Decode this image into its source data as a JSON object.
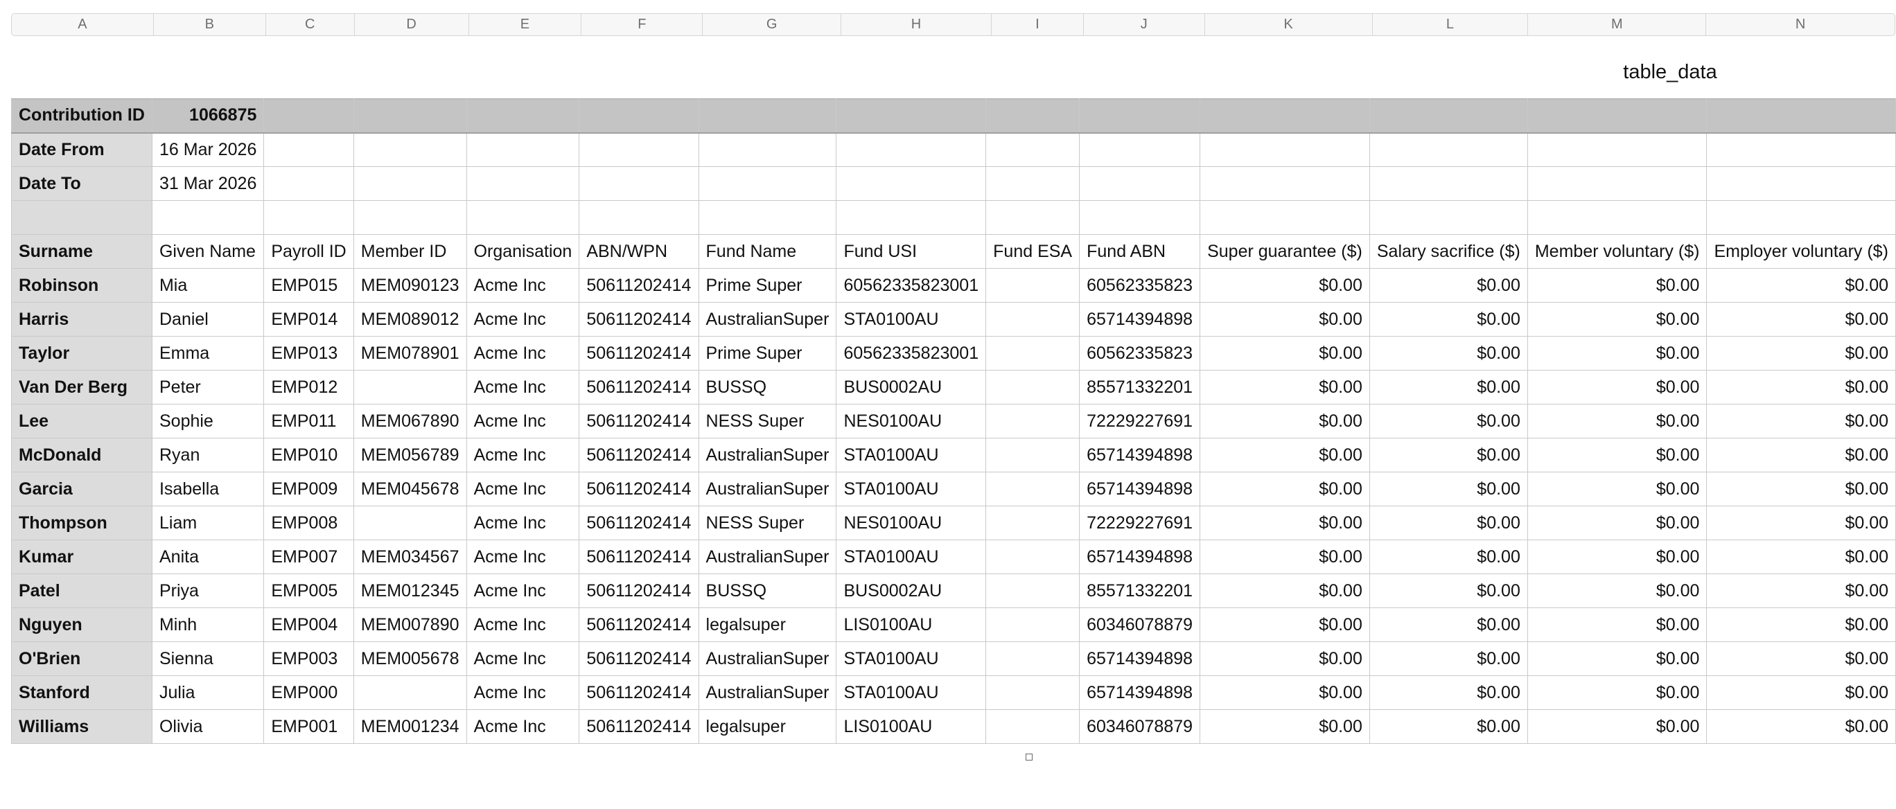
{
  "sheet": {
    "title": "table_data",
    "column_letters": [
      "A",
      "B",
      "C",
      "D",
      "E",
      "F",
      "G",
      "H",
      "I",
      "J",
      "K",
      "L",
      "M",
      "N"
    ]
  },
  "meta": {
    "contribution_id_label": "Contribution ID",
    "contribution_id": "1066875",
    "date_from_label": "Date From",
    "date_from": "16 Mar 2026",
    "date_to_label": "Date To",
    "date_to": "31 Mar 2026"
  },
  "table": {
    "headers": [
      "Surname",
      "Given Name",
      "Payroll ID",
      "Member ID",
      "Organisation",
      "ABN/WPN",
      "Fund Name",
      "Fund USI",
      "Fund ESA",
      "Fund ABN",
      "Super guarantee ($)",
      "Salary sacrifice ($)",
      "Member voluntary ($)",
      "Employer voluntary ($)"
    ],
    "rows": [
      [
        "Robinson",
        "Mia",
        "EMP015",
        "MEM090123",
        "Acme Inc",
        "50611202414",
        "Prime Super",
        "60562335823001",
        "",
        "60562335823",
        "$0.00",
        "$0.00",
        "$0.00",
        "$0.00"
      ],
      [
        "Harris",
        "Daniel",
        "EMP014",
        "MEM089012",
        "Acme Inc",
        "50611202414",
        "AustralianSuper",
        "STA0100AU",
        "",
        "65714394898",
        "$0.00",
        "$0.00",
        "$0.00",
        "$0.00"
      ],
      [
        "Taylor",
        "Emma",
        "EMP013",
        "MEM078901",
        "Acme Inc",
        "50611202414",
        "Prime Super",
        "60562335823001",
        "",
        "60562335823",
        "$0.00",
        "$0.00",
        "$0.00",
        "$0.00"
      ],
      [
        "Van Der Berg",
        "Peter",
        "EMP012",
        "",
        "Acme Inc",
        "50611202414",
        "BUSSQ",
        "BUS0002AU",
        "",
        "85571332201",
        "$0.00",
        "$0.00",
        "$0.00",
        "$0.00"
      ],
      [
        "Lee",
        "Sophie",
        "EMP011",
        "MEM067890",
        "Acme Inc",
        "50611202414",
        "NESS Super",
        "NES0100AU",
        "",
        "72229227691",
        "$0.00",
        "$0.00",
        "$0.00",
        "$0.00"
      ],
      [
        "McDonald",
        "Ryan",
        "EMP010",
        "MEM056789",
        "Acme Inc",
        "50611202414",
        "AustralianSuper",
        "STA0100AU",
        "",
        "65714394898",
        "$0.00",
        "$0.00",
        "$0.00",
        "$0.00"
      ],
      [
        "Garcia",
        "Isabella",
        "EMP009",
        "MEM045678",
        "Acme Inc",
        "50611202414",
        "AustralianSuper",
        "STA0100AU",
        "",
        "65714394898",
        "$0.00",
        "$0.00",
        "$0.00",
        "$0.00"
      ],
      [
        "Thompson",
        "Liam",
        "EMP008",
        "",
        "Acme Inc",
        "50611202414",
        "NESS Super",
        "NES0100AU",
        "",
        "72229227691",
        "$0.00",
        "$0.00",
        "$0.00",
        "$0.00"
      ],
      [
        "Kumar",
        "Anita",
        "EMP007",
        "MEM034567",
        "Acme Inc",
        "50611202414",
        "AustralianSuper",
        "STA0100AU",
        "",
        "65714394898",
        "$0.00",
        "$0.00",
        "$0.00",
        "$0.00"
      ],
      [
        "Patel",
        "Priya",
        "EMP005",
        "MEM012345",
        "Acme Inc",
        "50611202414",
        "BUSSQ",
        "BUS0002AU",
        "",
        "85571332201",
        "$0.00",
        "$0.00",
        "$0.00",
        "$0.00"
      ],
      [
        "Nguyen",
        "Minh",
        "EMP004",
        "MEM007890",
        "Acme Inc",
        "50611202414",
        "legalsuper",
        "LIS0100AU",
        "",
        "60346078879",
        "$0.00",
        "$0.00",
        "$0.00",
        "$0.00"
      ],
      [
        "O'Brien",
        "Sienna",
        "EMP003",
        "MEM005678",
        "Acme Inc",
        "50611202414",
        "AustralianSuper",
        "STA0100AU",
        "",
        "65714394898",
        "$0.00",
        "$0.00",
        "$0.00",
        "$0.00"
      ],
      [
        "Stanford",
        "Julia",
        "EMP000",
        "",
        "Acme Inc",
        "50611202414",
        "AustralianSuper",
        "STA0100AU",
        "",
        "65714394898",
        "$0.00",
        "$0.00",
        "$0.00",
        "$0.00"
      ],
      [
        "Williams",
        "Olivia",
        "EMP001",
        "MEM001234",
        "Acme Inc",
        "50611202414",
        "legalsuper",
        "LIS0100AU",
        "",
        "60346078879",
        "$0.00",
        "$0.00",
        "$0.00",
        "$0.00"
      ]
    ]
  },
  "colors": {
    "banner_fill": "#c4c4c4",
    "label_column_fill": "#dcdcdc",
    "grid_line": "#c9c9c9"
  }
}
